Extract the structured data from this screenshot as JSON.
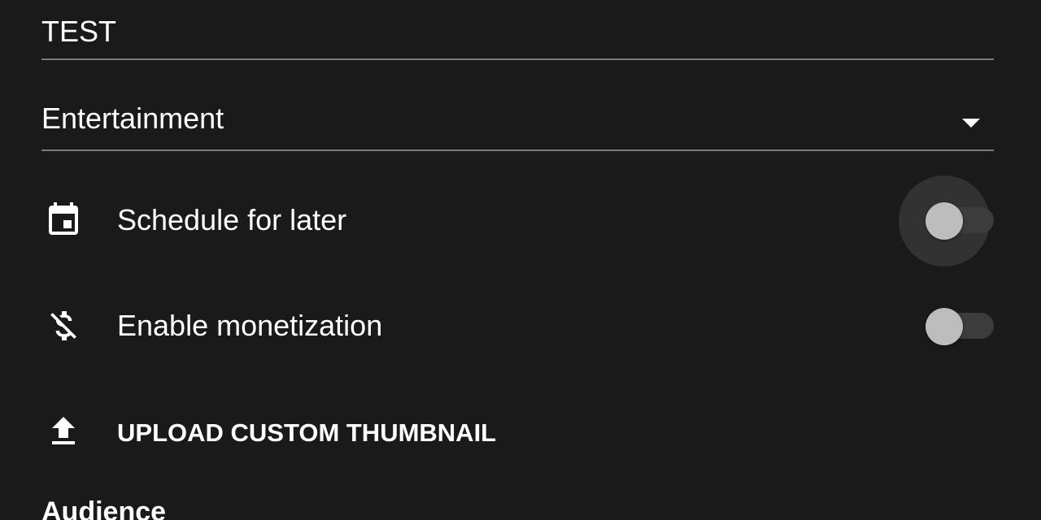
{
  "title_field": {
    "value": "TEST"
  },
  "category_field": {
    "value": "Entertainment",
    "icon": "arrow-drop-down-icon"
  },
  "settings": {
    "schedule": {
      "label": "Schedule for later",
      "icon": "calendar-icon",
      "enabled": false
    },
    "monetization": {
      "label": "Enable monetization",
      "icon": "monetization-off-icon",
      "enabled": false
    },
    "thumbnail": {
      "label": "UPLOAD CUSTOM THUMBNAIL",
      "icon": "upload-icon"
    }
  },
  "section": {
    "audience_heading": "Audience"
  },
  "colors": {
    "background": "#1a1a1a",
    "text": "#ffffff",
    "underline": "#7a7a7a",
    "toggle_thumb": "#bdbdbd",
    "toggle_track": "#3c3c3c"
  }
}
